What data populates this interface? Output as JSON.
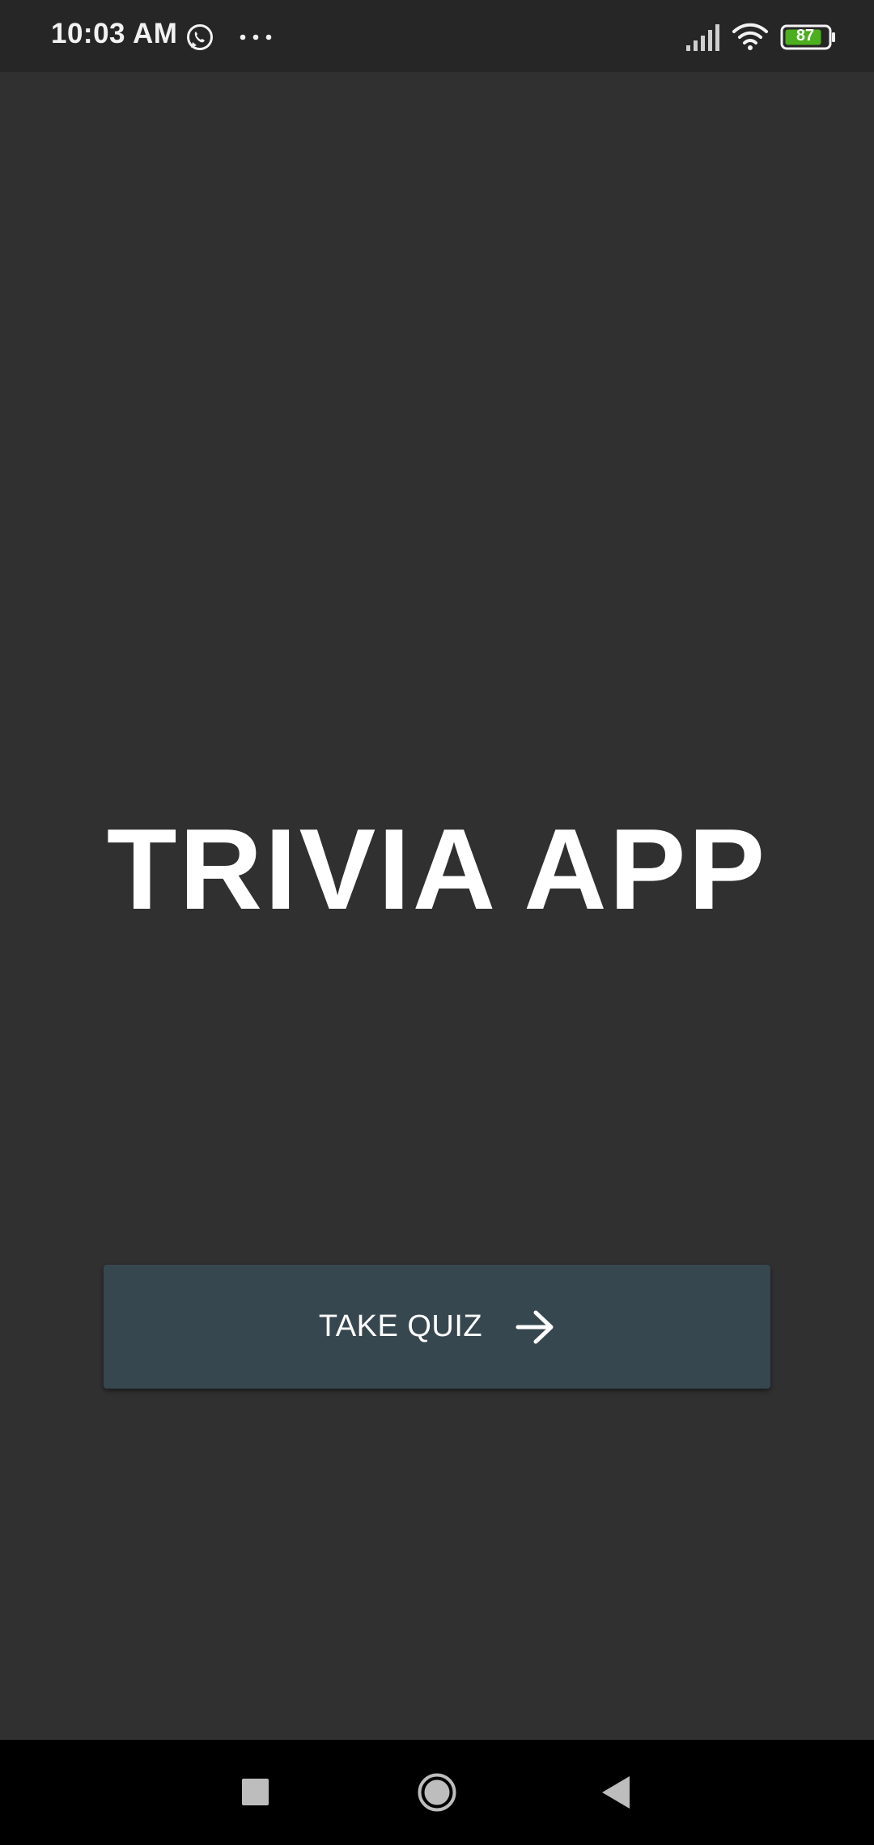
{
  "status_bar": {
    "time": "10:03 AM",
    "battery_level": "87",
    "icons": [
      "whatsapp-icon",
      "more-dots-icon",
      "signal-icon",
      "wifi-icon",
      "battery-icon"
    ]
  },
  "main": {
    "title": "TRIVIA APP",
    "take_quiz_label": "TAKE QUIZ",
    "button_icon": "arrow-right-icon"
  },
  "nav_bar": {
    "icons": [
      "recent-apps-icon",
      "home-icon",
      "back-icon"
    ]
  },
  "colors": {
    "background": "#303030",
    "status_bar": "#262626",
    "button": "#37474f",
    "battery_fill": "#4caf1e",
    "nav_bar": "#000000"
  }
}
